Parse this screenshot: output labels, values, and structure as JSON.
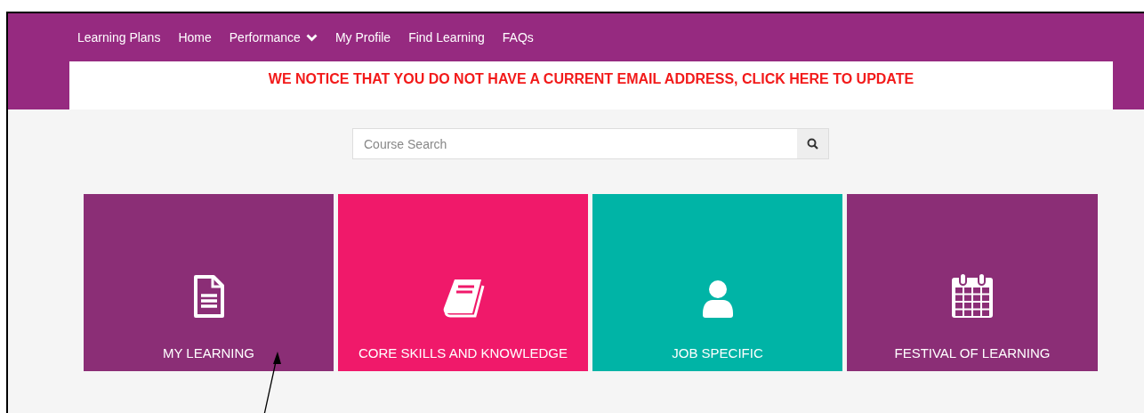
{
  "nav": [
    {
      "label": "Learning Plans",
      "kind": "link"
    },
    {
      "label": "Home",
      "kind": "link"
    },
    {
      "label": "Performance",
      "kind": "dropdown"
    },
    {
      "label": "My Profile",
      "kind": "link"
    },
    {
      "label": "Find Learning",
      "kind": "link"
    },
    {
      "label": "FAQs",
      "kind": "link"
    }
  ],
  "notice": "WE NOTICE THAT YOU DO NOT HAVE A CURRENT EMAIL ADDRESS, CLICK HERE TO UPDATE",
  "search": {
    "placeholder": "Course Search"
  },
  "tiles": [
    {
      "label": "MY LEARNING",
      "kind": "document",
      "color": "#8b2e76"
    },
    {
      "label": "CORE SKILLS AND KNOWLEDGE",
      "kind": "book",
      "color": "#f0196a"
    },
    {
      "label": "JOB SPECIFIC",
      "kind": "person",
      "color": "#00b4a6"
    },
    {
      "label": "FESTIVAL OF LEARNING",
      "kind": "calendar",
      "color": "#8b2e76"
    }
  ]
}
